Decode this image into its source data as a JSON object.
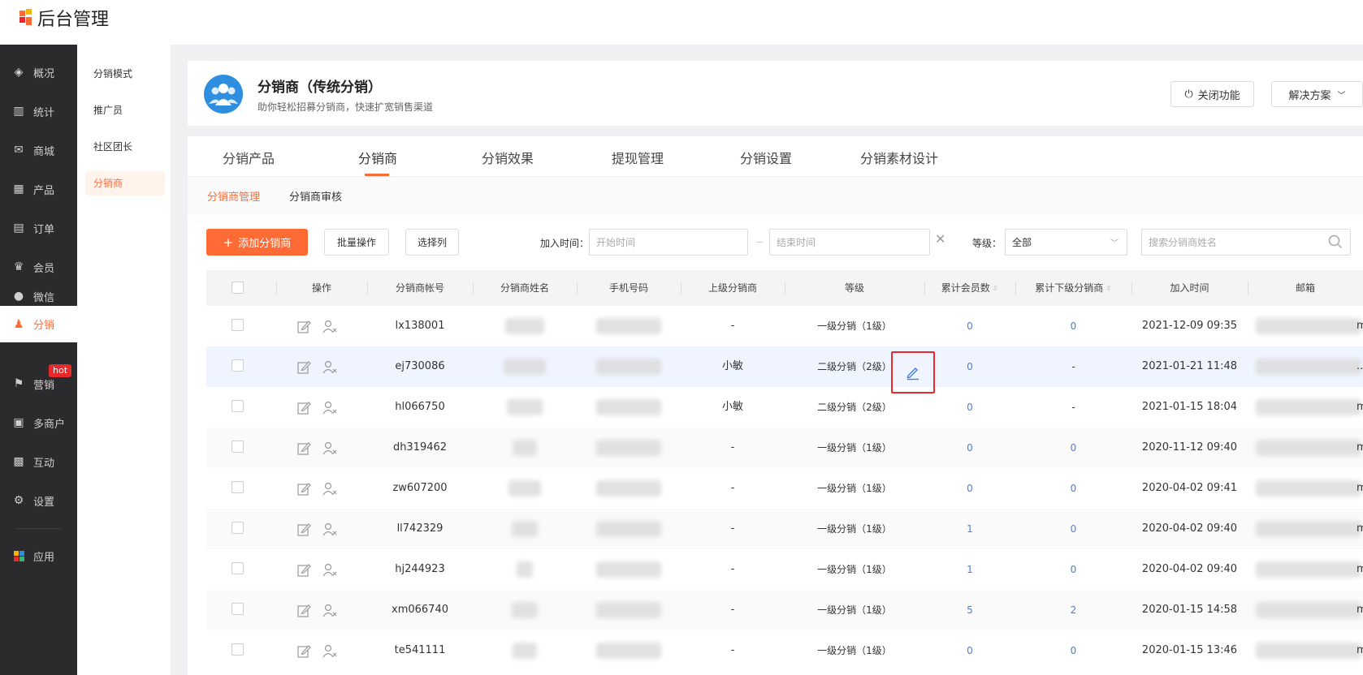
{
  "app": {
    "title": "后台管理"
  },
  "sidebar": {
    "items": [
      {
        "label": "概况",
        "icon": "layers-icon"
      },
      {
        "label": "统计",
        "icon": "chart-icon"
      },
      {
        "label": "商城",
        "icon": "mail-icon"
      },
      {
        "label": "产品",
        "icon": "grid-icon"
      },
      {
        "label": "订单",
        "icon": "order-icon"
      },
      {
        "label": "会员",
        "icon": "crown-icon"
      },
      {
        "label": "微信",
        "icon": "wechat-icon"
      },
      {
        "label": "分销",
        "icon": "users-icon"
      },
      {
        "label": "营销",
        "icon": "flag-icon"
      },
      {
        "label": "多商户",
        "icon": "shop-icon"
      },
      {
        "label": "互动",
        "icon": "interact-icon"
      },
      {
        "label": "设置",
        "icon": "gear-icon"
      },
      {
        "label": "应用",
        "icon": "apps-icon"
      }
    ],
    "hot_badge": "hot"
  },
  "subnav": {
    "items": [
      {
        "label": "分销模式"
      },
      {
        "label": "推广员"
      },
      {
        "label": "社区团长"
      },
      {
        "label": "分销商"
      }
    ]
  },
  "header": {
    "title": "分销商（传统分销）",
    "subtitle": "助你轻松招募分销商，快速扩宽销售渠道",
    "close_btn": "关闭功能",
    "solution_btn": "解决方案"
  },
  "tabs": [
    {
      "label": "分销产品"
    },
    {
      "label": "分销商"
    },
    {
      "label": "分销效果"
    },
    {
      "label": "提现管理"
    },
    {
      "label": "分销设置"
    },
    {
      "label": "分销素材设计"
    }
  ],
  "subtabs": [
    {
      "label": "分销商管理"
    },
    {
      "label": "分销商审核"
    }
  ],
  "toolbar": {
    "add_btn": "添加分销商",
    "batch_btn": "批量操作",
    "columns_btn": "选择列",
    "join_time_label": "加入时间：",
    "start_placeholder": "开始时间",
    "end_placeholder": "结束时间",
    "level_label": "等级：",
    "level_value": "全部",
    "search_placeholder": "搜索分销商姓名"
  },
  "table": {
    "columns": [
      "操作",
      "分销商帐号",
      "分销商姓名",
      "手机号码",
      "上级分销商",
      "等级",
      "累计会员数",
      "累计下级分销商",
      "加入时间",
      "邮箱"
    ],
    "rows": [
      {
        "account": "lx138001",
        "parent": "-",
        "level": "一级分销（1级）",
        "members": "0",
        "subs": "0",
        "time": "2021-12-09 09:35",
        "tail": "m"
      },
      {
        "account": "ej730086",
        "parent": "小敏",
        "level": "二级分销（2级）",
        "members": "0",
        "subs": "-",
        "time": "2021-01-21 11:48",
        "tail": "..."
      },
      {
        "account": "hl066750",
        "parent": "小敏",
        "level": "二级分销（2级）",
        "members": "0",
        "subs": "-",
        "time": "2021-01-15 18:04",
        "tail": "m"
      },
      {
        "account": "dh319462",
        "parent": "-",
        "level": "一级分销（1级）",
        "members": "0",
        "subs": "0",
        "time": "2020-11-12 09:40",
        "tail": "m"
      },
      {
        "account": "zw607200",
        "parent": "-",
        "level": "一级分销（1级）",
        "members": "0",
        "subs": "0",
        "time": "2020-04-02 09:41",
        "tail": "m"
      },
      {
        "account": "ll742329",
        "parent": "-",
        "level": "一级分销（1级）",
        "members": "1",
        "subs": "0",
        "time": "2020-04-02 09:40",
        "tail": "m"
      },
      {
        "account": "hj244923",
        "parent": "-",
        "level": "一级分销（1级）",
        "members": "1",
        "subs": "0",
        "time": "2020-04-02 09:40",
        "tail": "m"
      },
      {
        "account": "xm066740",
        "parent": "-",
        "level": "一级分销（1级）",
        "members": "5",
        "subs": "2",
        "time": "2020-01-15 14:58",
        "tail": "m"
      },
      {
        "account": "te541111",
        "parent": "-",
        "level": "一级分销（1级）",
        "members": "0",
        "subs": "0",
        "time": "2020-01-15 13:46",
        "tail": "m"
      }
    ]
  },
  "colors": {
    "accent": "#ff6b35",
    "link": "#4a7de0",
    "sidebar_bg": "#2b2b2e",
    "highlight": "#e8282b"
  }
}
